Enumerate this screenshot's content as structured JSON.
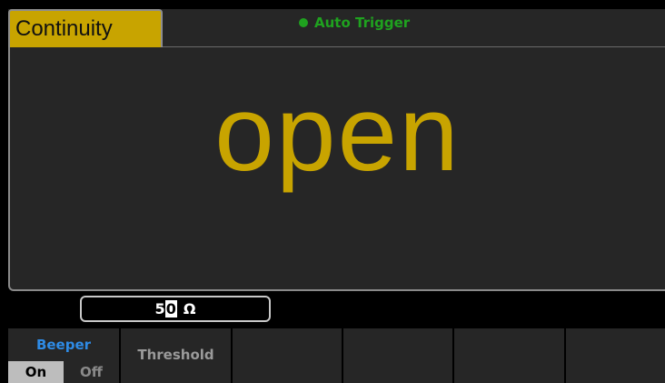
{
  "header": {
    "mode_label": "Continuity",
    "trigger_label": "Auto Trigger"
  },
  "display": {
    "reading": "open"
  },
  "threshold_input": {
    "value_digits_before": "5",
    "value_cursor_digit": "0",
    "unit": "Ω"
  },
  "softkeys": {
    "beeper": {
      "label": "Beeper",
      "on_label": "On",
      "off_label": "Off",
      "selected": "On"
    },
    "threshold": {
      "label": "Threshold"
    }
  },
  "colors": {
    "accent_yellow": "#c8a400",
    "trigger_green": "#1fa21f",
    "beeper_blue": "#2e8be6",
    "panel_gray": "#262626"
  }
}
